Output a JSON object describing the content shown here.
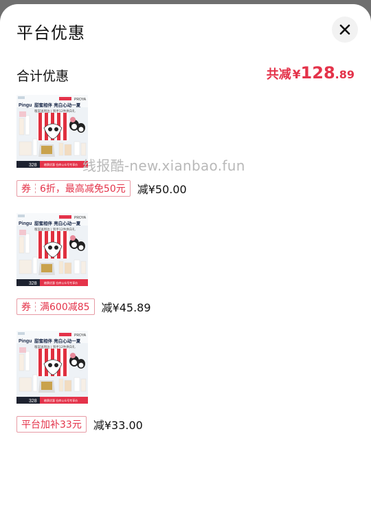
{
  "panel": {
    "title": "平台优惠",
    "close_label": "×"
  },
  "summary": {
    "label": "合计优惠",
    "prefix": "共减",
    "currency": "¥",
    "amount_int": "128",
    "amount_dec": ".89"
  },
  "watermark": "线报酷-new.xianbao.fun",
  "items": [
    {
      "tag_type": "券",
      "tag_text": "6折，最高减免50元",
      "amount": "减¥50.00",
      "image": {
        "brand": "Pingu",
        "headline": "甜蜜相伴 亮白心动一夏",
        "subline": "粮案送周边 | 到手12件焕白礼",
        "logo_text": "PROYA",
        "price": "328",
        "footer": "粮票优惠 仓库公众号专享价"
      }
    },
    {
      "tag_type": "券",
      "tag_text": "满600减85",
      "amount": "减¥45.89",
      "image": {
        "brand": "Pingu",
        "headline": "甜蜜相伴 亮白心动一夏",
        "subline": "粮案送周边 | 到手12件焕白礼",
        "logo_text": "PROYA",
        "price": "328",
        "footer": "粮票优惠 仓库公众号专享价"
      }
    },
    {
      "tag_type": "",
      "tag_text": "平台加补33元",
      "amount": "减¥33.00",
      "image": {
        "brand": "Pingu",
        "headline": "甜蜜相伴 亮白心动一夏",
        "subline": "粮案送周边 | 到手12件焕白礼",
        "logo_text": "PROYA",
        "price": "328",
        "footer": "粮票优惠 仓库公众号专享价"
      }
    }
  ]
}
